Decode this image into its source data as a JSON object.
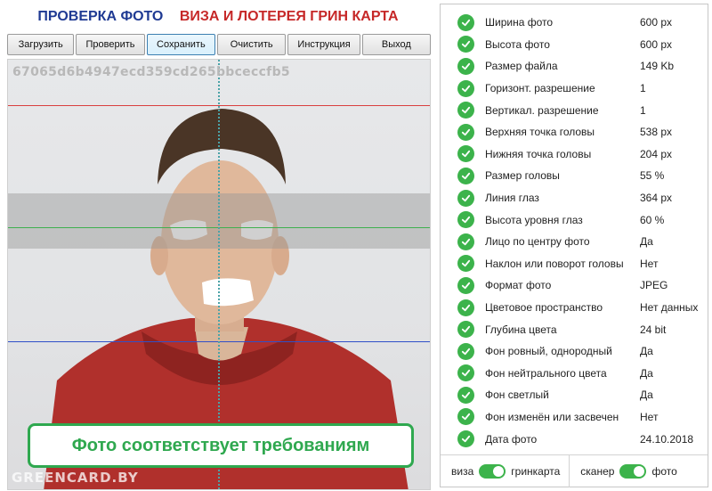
{
  "header": {
    "title_left": "ПРОВЕРКА ФОТО",
    "title_right": "ВИЗА И ЛОТЕРЕЯ ГРИН КАРТА"
  },
  "toolbar": {
    "load": "Загрузить",
    "check": "Проверить",
    "save": "Сохранить",
    "clear": "Очистить",
    "instructions": "Инструкция",
    "exit": "Выход",
    "active": "save"
  },
  "photo": {
    "hash": "67065d6b4947ecd359cd265bbceccfb5",
    "verdict": "Фото соответствует требованиям",
    "watermark": "GREENCARD.BY",
    "colors": {
      "top_line": "#d94040",
      "eye_line": "#3fb04f",
      "bottom_line": "#3050c8",
      "center_line": "#4ba3a8",
      "verdict": "#2fa84f"
    }
  },
  "results": [
    {
      "label": "Ширина фото",
      "value": "600 px"
    },
    {
      "label": "Высота фото",
      "value": "600 px"
    },
    {
      "label": "Размер файла",
      "value": "149 Kb"
    },
    {
      "label": "Горизонт. разрешение",
      "value": "1"
    },
    {
      "label": "Вертикал. разрешение",
      "value": "1"
    },
    {
      "label": "Верхняя точка головы",
      "value": "538 px"
    },
    {
      "label": "Нижняя точка головы",
      "value": "204 px"
    },
    {
      "label": "Размер головы",
      "value": "55 %"
    },
    {
      "label": "Линия глаз",
      "value": "364 px"
    },
    {
      "label": "Высота уровня глаз",
      "value": "60 %"
    },
    {
      "label": "Лицо по центру фото",
      "value": "Да"
    },
    {
      "label": "Наклон или поворот головы",
      "value": "Нет"
    },
    {
      "label": "Формат фото",
      "value": "JPEG"
    },
    {
      "label": "Цветовое пространство",
      "value": "Нет данных"
    },
    {
      "label": "Глубина цвета",
      "value": "24 bit"
    },
    {
      "label": "Фон ровный, однородный",
      "value": "Да"
    },
    {
      "label": "Фон нейтрального цвета",
      "value": "Да"
    },
    {
      "label": "Фон светлый",
      "value": "Да"
    },
    {
      "label": "Фон изменён или засвечен",
      "value": "Нет"
    },
    {
      "label": "Дата фото",
      "value": "24.10.2018"
    }
  ],
  "footer": {
    "left_a": "виза",
    "left_b": "гринкарта",
    "right_a": "сканер",
    "right_b": "фото",
    "toggle_color": "#3cb34b"
  }
}
